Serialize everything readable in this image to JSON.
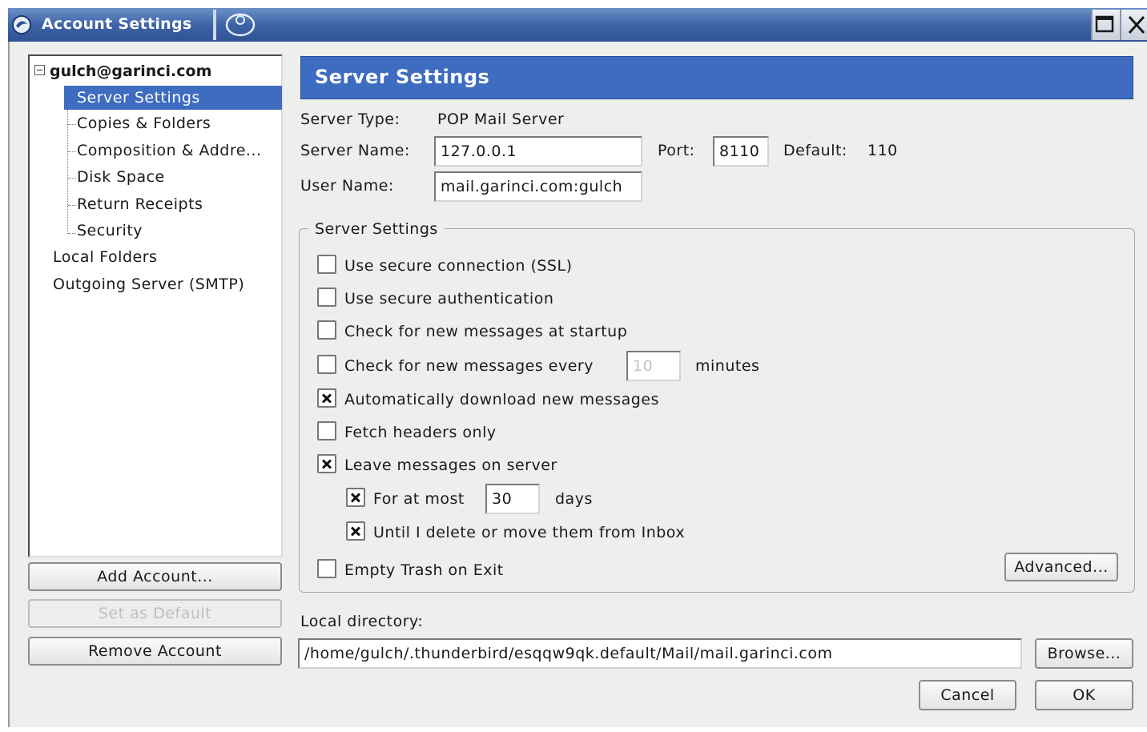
{
  "window": {
    "title": "Account Settings",
    "icons": [
      "app-icon",
      "toolbar-icon",
      "maximize-icon",
      "close-icon"
    ]
  },
  "tree": {
    "account": "gulch@garinci.com",
    "children": [
      {
        "label": "Server Settings",
        "selected": true
      },
      {
        "label": "Copies & Folders"
      },
      {
        "label": "Composition & Addre..."
      },
      {
        "label": "Disk Space"
      },
      {
        "label": "Return Receipts"
      },
      {
        "label": "Security"
      }
    ],
    "top_items": [
      "Local Folders",
      "Outgoing Server (SMTP)"
    ]
  },
  "left_buttons": {
    "add_account": "Add Account...",
    "set_default": "Set as Default",
    "remove_account": "Remove Account"
  },
  "panel": {
    "title": "Server Settings",
    "server_type_label": "Server Type:",
    "server_type_value": "POP Mail Server",
    "server_name_label": "Server Name:",
    "server_name_value": "127.0.0.1",
    "port_label": "Port:",
    "port_value": "8110",
    "default_label": "Default:",
    "default_value": "110",
    "user_name_label": "User Name:",
    "user_name_value": "mail.garinci.com:gulch"
  },
  "group": {
    "legend": "Server Settings",
    "options": [
      {
        "label": "Use secure connection (SSL)",
        "checked": false
      },
      {
        "label": "Use secure authentication",
        "checked": false
      },
      {
        "label": "Check for new messages at startup",
        "checked": false
      },
      {
        "label": "Check for new messages every",
        "checked": false
      },
      {
        "label": "Automatically download new messages",
        "checked": true
      },
      {
        "label": "Fetch headers only",
        "checked": false
      },
      {
        "label": "Leave messages on server",
        "checked": true
      },
      {
        "label": "For at most",
        "checked": true
      },
      {
        "label": "Until I delete or move them from Inbox",
        "checked": true
      },
      {
        "label": "Empty Trash on Exit",
        "checked": false
      }
    ],
    "check_interval_value": "10",
    "minutes_label": "minutes",
    "days_value": "30",
    "days_label": "days",
    "advanced_button": "Advanced..."
  },
  "local_dir": {
    "label": "Local directory:",
    "value": "/home/gulch/.thunderbird/esqqw9qk.default/Mail/mail.garinci.com",
    "browse_button": "Browse..."
  },
  "dialog_buttons": {
    "cancel": "Cancel",
    "ok": "OK"
  }
}
